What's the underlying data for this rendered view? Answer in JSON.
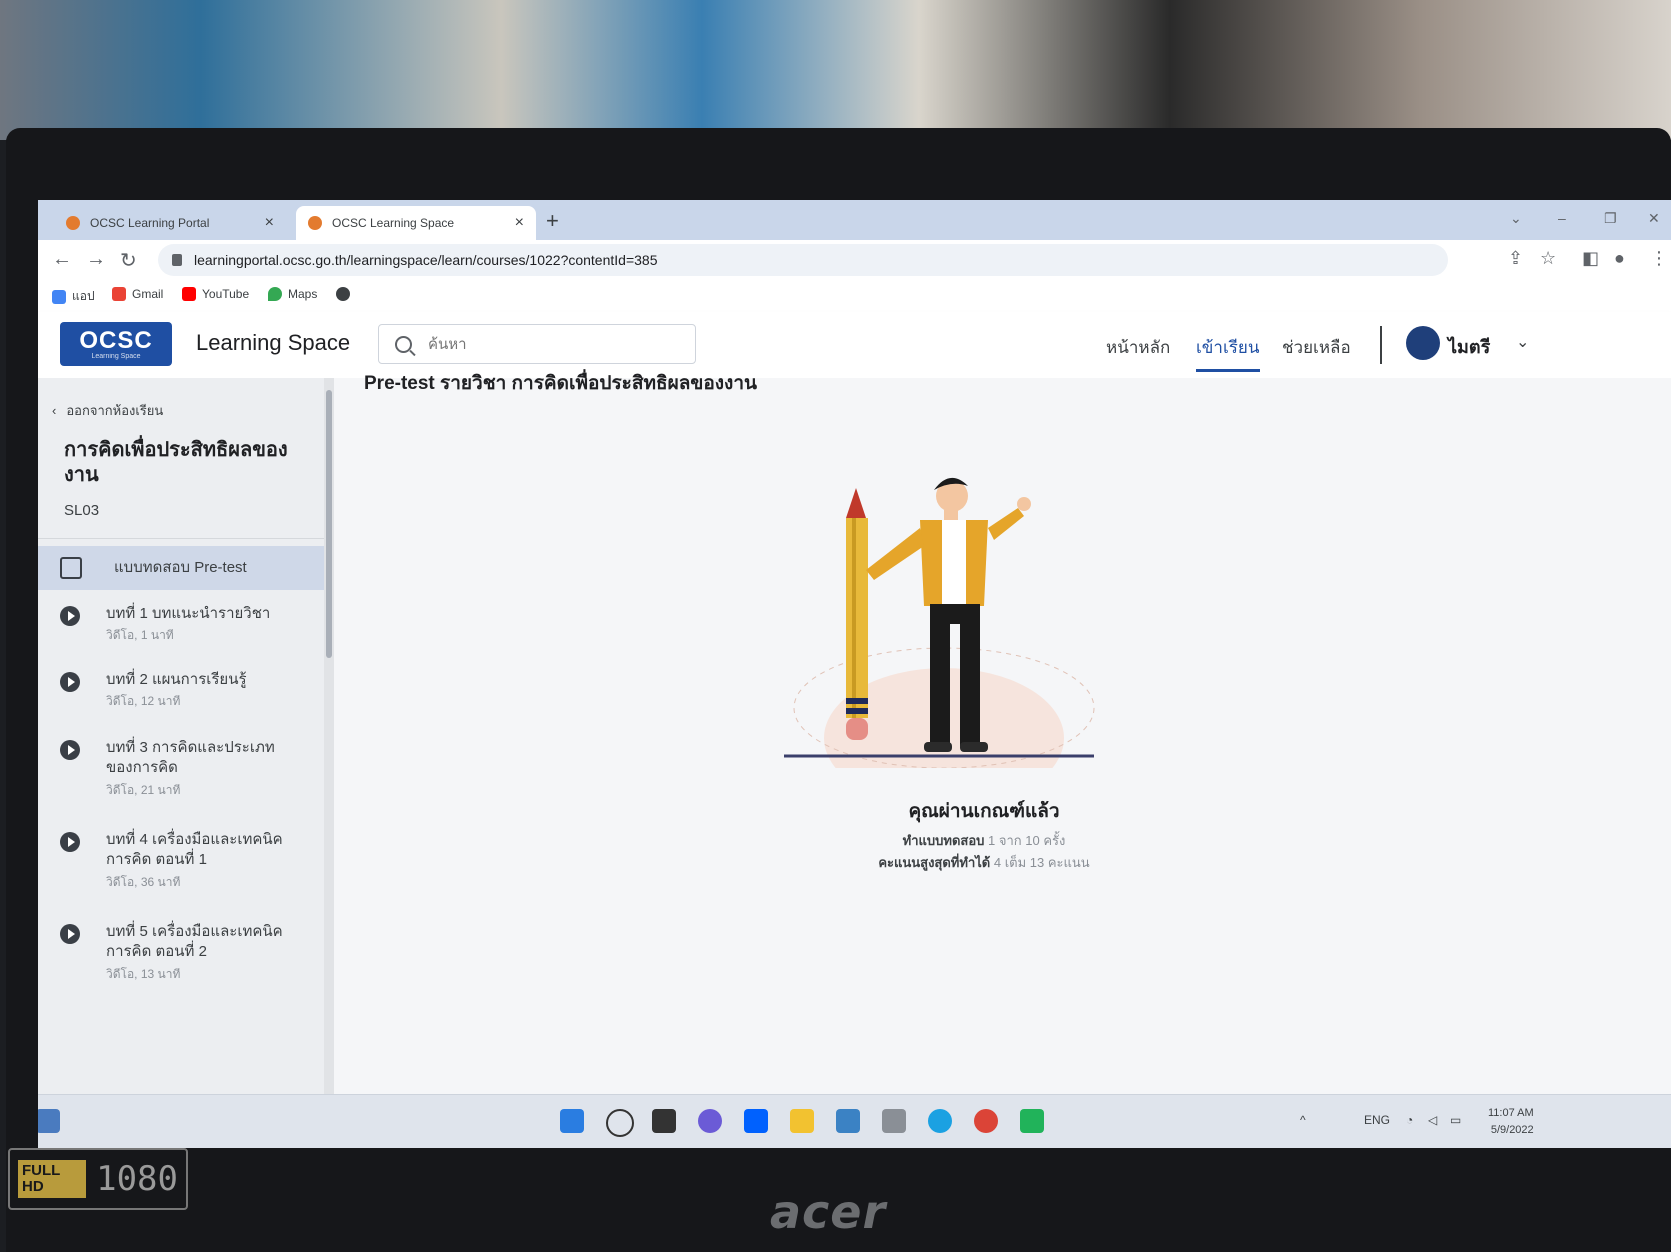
{
  "browser": {
    "tabs": [
      {
        "label": "OCSC Learning Portal",
        "active": false
      },
      {
        "label": "OCSC Learning Space",
        "active": true
      }
    ],
    "new_tab": "+",
    "url": "learningportal.ocsc.go.th/learningspace/learn/courses/1022?contentId=385",
    "bookmarks": [
      "แอป",
      "Gmail",
      "YouTube",
      "Maps"
    ]
  },
  "header": {
    "logo_text": "OCSC",
    "logo_sub": "Learning Space",
    "site_title": "Learning Space",
    "search_placeholder": "ค้นหา",
    "nav": [
      {
        "label": "หน้าหลัก",
        "active": false
      },
      {
        "label": "เข้าเรียน",
        "active": true
      },
      {
        "label": "ช่วยเหลือ",
        "active": false
      }
    ],
    "user_name": "ไมตรี"
  },
  "sidebar": {
    "back_label": "ออกจากห้องเรียน",
    "course_title": "การคิดเพื่อประสิทธิผลของงาน",
    "course_code": "SL03",
    "active_item": "แบบทดสอบ Pre-test",
    "lessons": [
      {
        "title": "บทที่ 1 บทแนะนำรายวิชา",
        "meta": "วิดีโอ, 1 นาที"
      },
      {
        "title": "บทที่ 2 แผนการเรียนรู้",
        "meta": "วิดีโอ, 12 นาที"
      },
      {
        "title": "บทที่ 3 การคิดและประเภทของการคิด",
        "meta": "วิดีโอ, 21 นาที"
      },
      {
        "title": "บทที่ 4 เครื่องมือและเทคนิคการคิด ตอนที่ 1",
        "meta": "วิดีโอ, 36 นาที"
      },
      {
        "title": "บทที่ 5 เครื่องมือและเทคนิคการคิด ตอนที่ 2",
        "meta": "วิดีโอ, 13 นาที"
      }
    ]
  },
  "main": {
    "page_title": "Pre-test รายวิชา การคิดเพื่อประสิทธิผลของงาน",
    "result_title": "คุณผ่านเกณฑ์แล้ว",
    "attempts_label": "ทำแบบทดสอบ",
    "attempts_value": "1 จาก 10 ครั้ง",
    "score_label": "คะแนนสูงสุดที่ทำได้",
    "score_value": "4 เต็ม 13 คะแนน"
  },
  "taskbar": {
    "lang": "ENG",
    "time": "11:07 AM",
    "date": "5/9/2022"
  },
  "device": {
    "hd_badge": "FULL HD",
    "resolution": "1080",
    "brand": "acer"
  },
  "colors": {
    "primary": "#1f4fa3",
    "sidebar_bg": "#eceef1",
    "active_item_bg": "#cfd8e8",
    "jacket": "#e5a52a",
    "pencil": "#e8b93a"
  }
}
